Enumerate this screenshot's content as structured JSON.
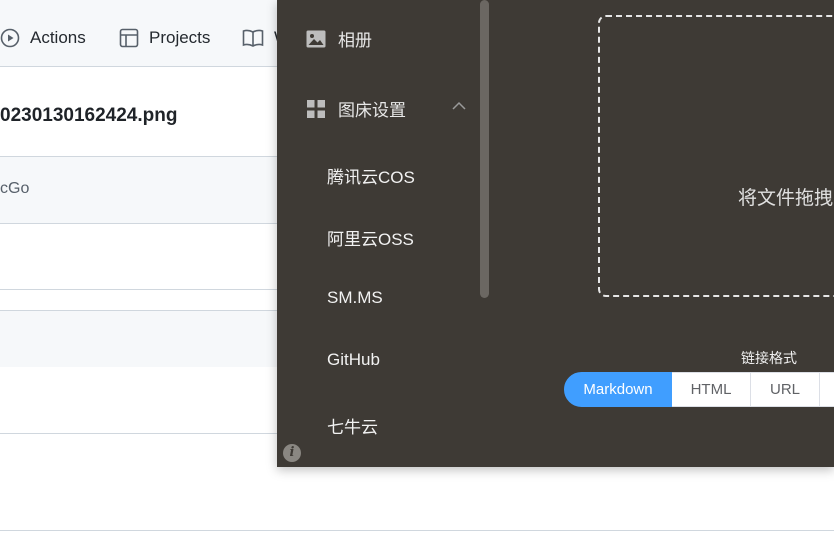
{
  "github": {
    "nav": {
      "actions": "Actions",
      "projects": "Projects",
      "wiki_partial": "W"
    },
    "file": {
      "name": "0230130162424.png"
    },
    "commit": {
      "text": "cGo"
    }
  },
  "picgo": {
    "sidebar": {
      "album": "相册",
      "bed_settings": "图床设置",
      "beds": [
        "腾讯云COS",
        "阿里云OSS",
        "SM.MS",
        "GitHub",
        "七牛云"
      ]
    },
    "info_icon": "i",
    "upload": {
      "drop_text": "将文件拖拽"
    },
    "link_format": {
      "label": "链接格式",
      "options": [
        "Markdown",
        "HTML",
        "URL"
      ],
      "selected": "Markdown"
    }
  },
  "colors": {
    "picgo_bg": "#3e3a35",
    "accent": "#409eff",
    "github_nav_bg": "#f6f8fa"
  }
}
